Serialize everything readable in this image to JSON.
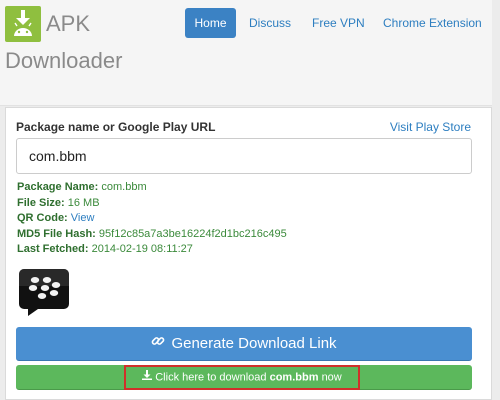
{
  "brand": {
    "line1": "APK",
    "line2": "Downloader",
    "logo_icon": "android-download-icon",
    "logo_color": "#8fbf3f"
  },
  "nav": {
    "items": [
      {
        "label": "Home",
        "active": true
      },
      {
        "label": "Discuss",
        "active": false
      },
      {
        "label": "Free VPN",
        "active": false
      },
      {
        "label": "Chrome Extension",
        "active": false
      }
    ]
  },
  "form": {
    "field_label": "Package name or Google Play URL",
    "play_link": "Visit Play Store",
    "input_value": "com.bbm"
  },
  "info": {
    "package_name_key": "Package Name:",
    "package_name_val": "com.bbm",
    "file_size_key": "File Size:",
    "file_size_val": "16 MB",
    "qr_key": "QR Code:",
    "qr_val": "View",
    "md5_key": "MD5 File Hash:",
    "md5_val": "95f12c85a7a3be16224f2d1bc216c495",
    "fetched_key": "Last Fetched:",
    "fetched_val": "2014-02-19 08:11:27"
  },
  "app_icon": "blackberry-messenger-icon",
  "buttons": {
    "generate_label": "Generate Download Link",
    "generate_icon": "link-icon",
    "download_prefix": "Click here to download",
    "download_pkg": "com.bbm",
    "download_suffix": "now",
    "download_icon": "download-icon"
  },
  "colors": {
    "accent": "#3b82c4",
    "success": "#5cb85c",
    "highlight": "#d0302a"
  }
}
